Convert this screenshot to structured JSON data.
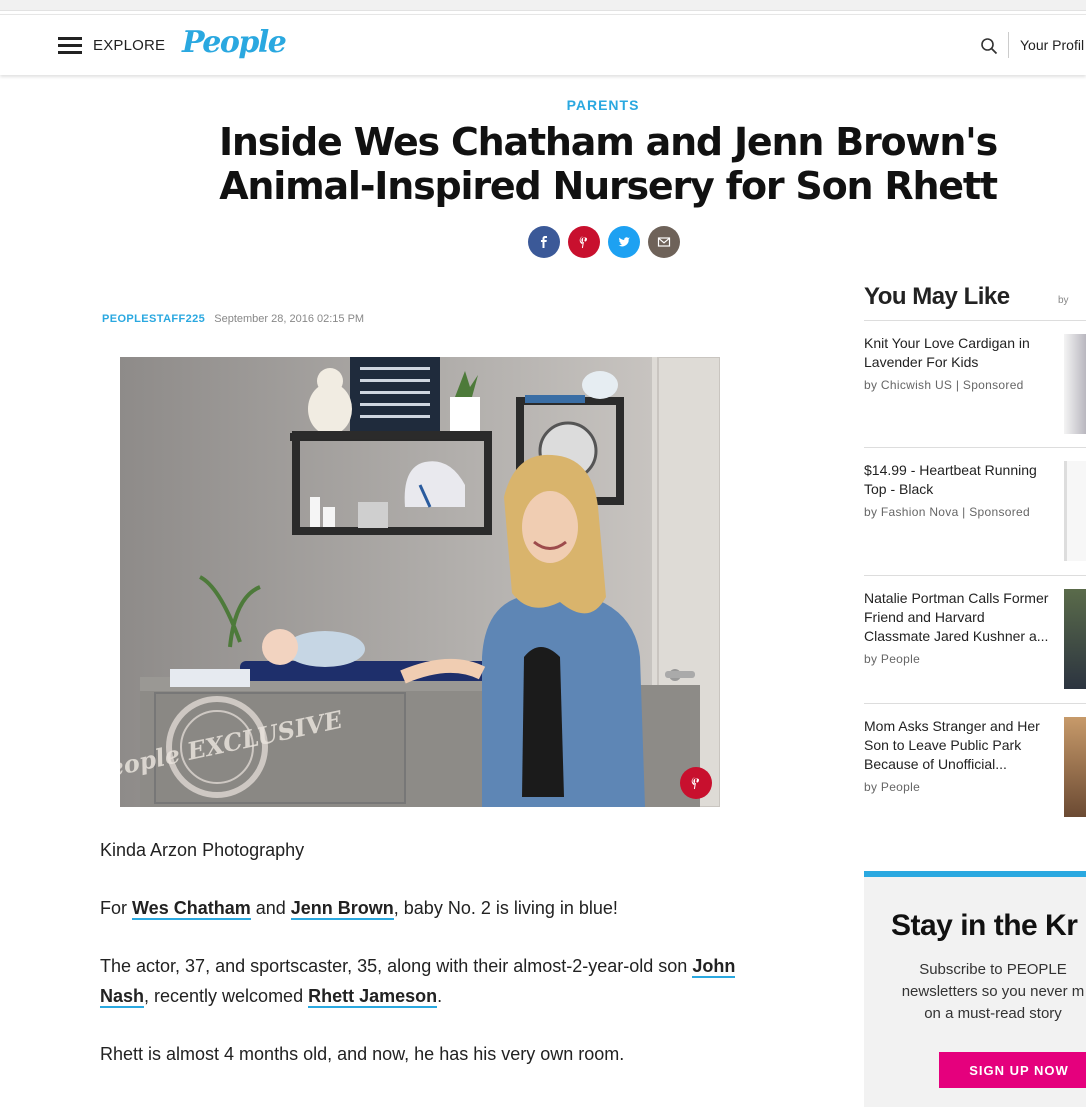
{
  "header": {
    "menu_label": "EXPLORE",
    "logo": "People",
    "profile_label": "Your Profil"
  },
  "article": {
    "category": "PARENTS",
    "headline": "Inside Wes Chatham and Jenn Brown's Animal-Inspired Nursery for Son Rhett",
    "author": "PEOPLESTAFF225",
    "date": "September 28, 2016 02:15 PM",
    "photo_caption": "Kinda Arzon Photography",
    "watermark": "People EXCLUSIVE",
    "p1": {
      "t1": "For ",
      "l1": "Wes Chatham",
      "t2": " and ",
      "l2": "Jenn Brown",
      "t3": ", baby No. 2 is living in blue!"
    },
    "p2": {
      "t1": "The actor, 37, and sportscaster, 35, along with their almost-2-year-old son ",
      "l1": "John Nash",
      "t2": ", recently welcomed ",
      "l2": "Rhett Jameson",
      "t3": "."
    },
    "p3": "Rhett is almost 4 months old, and now, he has his very own room."
  },
  "share": {
    "facebook": "facebook-icon",
    "pinterest": "pinterest-icon",
    "twitter": "twitter-icon",
    "email": "email-icon",
    "colors": {
      "facebook": "#3b5998",
      "pinterest": "#c8102e",
      "twitter": "#1da1f2",
      "email": "#6e6259"
    }
  },
  "sidebar": {
    "heading": "You May Like",
    "by": "by",
    "items": [
      {
        "title": "Knit Your Love Cardigan in Lavender For Kids",
        "source": "by Chicwish US | Sponsored"
      },
      {
        "title": "$14.99 - Heartbeat Running Top - Black",
        "source": "by Fashion Nova | Sponsored"
      },
      {
        "title": "Natalie Portman Calls Former Friend and Harvard Classmate Jared Kushner a...",
        "source": "by People"
      },
      {
        "title": "Mom Asks Stranger and Her Son to Leave Public Park Because of Unofficial...",
        "source": "by People"
      }
    ]
  },
  "newsletter": {
    "title": "Stay in the Kr",
    "line1": "Subscribe to PEOPLE",
    "line2": "newsletters so you never m",
    "line3": "on a must-read story",
    "button": "SIGN UP NOW"
  },
  "colors": {
    "accent": "#2aa8e0",
    "signup": "#e5007d"
  }
}
